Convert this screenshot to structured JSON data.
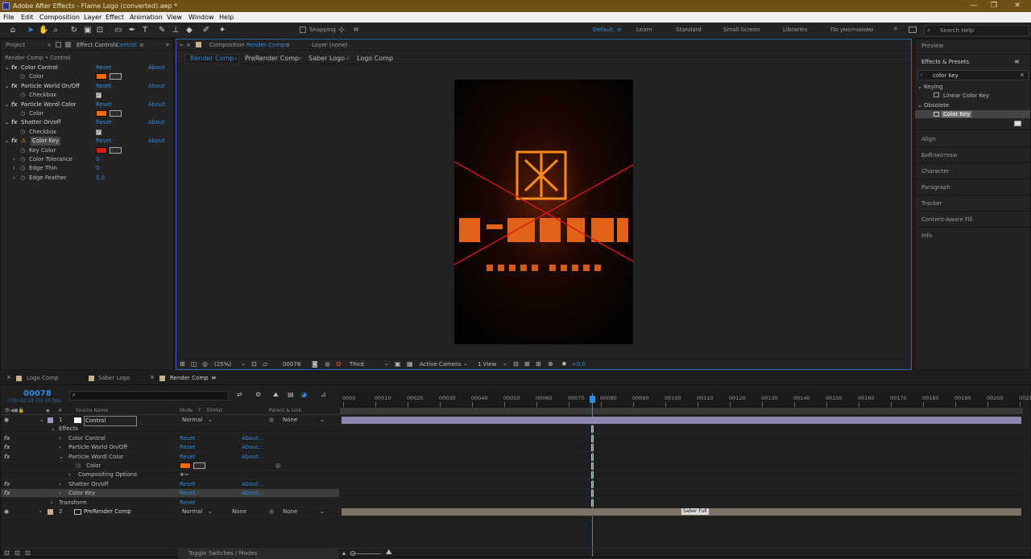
{
  "window": {
    "title": "Adobe After Effects - Flame Logo (converted).aep *",
    "controls": [
      "—",
      "❐",
      "✕"
    ]
  },
  "menu": [
    "File",
    "Edit",
    "Composition",
    "Layer",
    "Effect",
    "Animation",
    "View",
    "Window",
    "Help"
  ],
  "toolbar": {
    "snapping_label": "Snapping",
    "workspaces": [
      "Default",
      "Learn",
      "Standard",
      "Small Screen",
      "Libraries",
      "По умолчанию"
    ],
    "more": "»",
    "search_help_placeholder": "Search Help"
  },
  "left_panel": {
    "tab_project": "Project",
    "tab_effect_controls": "Effect Controls",
    "tab_effect_target": "Control",
    "breadcrumb": "Render Comp • Control",
    "effects": [
      {
        "fx": "fx",
        "name": "Color Control",
        "reset": "Reset",
        "about": "About"
      },
      {
        "fx": "",
        "name": "Color",
        "swatch": "#ff6a00"
      },
      {
        "fx": "fx",
        "name": "Particle World On/Off",
        "reset": "Reset",
        "about": "About"
      },
      {
        "fx": "",
        "name": "Checkbox",
        "checked": true
      },
      {
        "fx": "fx",
        "name": "Particle Wordl Color",
        "reset": "Reset",
        "about": "About"
      },
      {
        "fx": "",
        "name": "Color",
        "swatch": "#ff6a00"
      },
      {
        "fx": "fx",
        "name": "Shatter On/off",
        "reset": "Reset",
        "about": "About"
      },
      {
        "fx": "",
        "name": "Checkbox",
        "checked": true
      },
      {
        "fx": "fx",
        "name": "Color Key",
        "reset": "Reset",
        "about": "About",
        "warning": true
      },
      {
        "fx": "",
        "name": "Key Color",
        "swatch": "#e11818"
      },
      {
        "fx": "",
        "name": "Color Tolerance",
        "value": "0"
      },
      {
        "fx": "",
        "name": "Edge Thin",
        "value": "0"
      },
      {
        "fx": "",
        "name": "Edge Feather",
        "value": "0,0"
      }
    ]
  },
  "comp_panel": {
    "tab_comp": "Composition",
    "tab_comp_name": "Render Comp",
    "tab_layer": "Layer (none)",
    "nav": [
      "Render Comp",
      "PreRender Comp",
      "Saber Logo",
      "Logo Comp"
    ],
    "viewer_bottom": {
      "zoom": "(25%)",
      "frame": "00078",
      "resolution": "Third",
      "camera": "Active Camera",
      "views": "1 View",
      "exposure": "+0,0"
    }
  },
  "right_panel": {
    "preview": "Preview",
    "effects_presets": "Effects & Presets",
    "search_value": "color key",
    "tree": [
      {
        "label": "Keying",
        "level": 0
      },
      {
        "label": "Linear Color Key",
        "level": 1
      },
      {
        "label": "Obsolete",
        "level": 0
      },
      {
        "label": "Color Key",
        "level": 1,
        "selected": true
      }
    ],
    "panels": [
      "Align",
      "Библиотеки",
      "Character",
      "Paragraph",
      "Tracker",
      "Content-Aware Fill",
      "Info"
    ]
  },
  "timeline": {
    "tabs": [
      "Logo Comp",
      "Saber Logo",
      "Render Comp"
    ],
    "current_time": "00078",
    "time_sub": "0:00:02:18 (30.00 fps)",
    "columns": {
      "source": "Source Name",
      "mode": "Mode",
      "t": "T",
      "trkmat": "TrkMat",
      "parent": "Parent & Link"
    },
    "ruler": [
      "0000",
      "00010",
      "00020",
      "00030",
      "00040",
      "00050",
      "00060",
      "00070",
      "00080",
      "00090",
      "00100",
      "00110",
      "00120",
      "00130",
      "00140",
      "00150",
      "00160",
      "00170",
      "00180",
      "00190",
      "00200",
      "0021"
    ],
    "rows": [
      {
        "fx": "",
        "num": "1",
        "name": "Control",
        "mode": "Normal",
        "trk": "",
        "parent": "None",
        "type": "layer"
      },
      {
        "fx": "",
        "name": "Effects",
        "type": "group"
      },
      {
        "fx": "fx",
        "name": "Color Control",
        "reset": "Reset",
        "about": "About...",
        "type": "effect"
      },
      {
        "fx": "fx",
        "name": "Particle World On/Off",
        "reset": "Reset",
        "about": "About...",
        "type": "effect"
      },
      {
        "fx": "fx",
        "name": "Particle Wordl Color",
        "reset": "Reset",
        "about": "About...",
        "type": "effect"
      },
      {
        "fx": "",
        "name": "Color",
        "type": "prop",
        "swatch": "#ff6a00"
      },
      {
        "fx": "",
        "name": "Compositing Options",
        "type": "prop2",
        "extra": "+−"
      },
      {
        "fx": "fx",
        "name": "Shatter On/off",
        "reset": "Reset",
        "about": "About...",
        "type": "effect"
      },
      {
        "fx": "fx",
        "name": "Color Key",
        "reset": "Reset",
        "about": "About...",
        "type": "effect",
        "selected": true
      },
      {
        "fx": "",
        "name": "Transform",
        "reset": "Reset",
        "type": "group"
      },
      {
        "fx": "",
        "num": "2",
        "name": "PreRender Comp",
        "mode": "Normal",
        "trk": "None",
        "parent": "None",
        "type": "layer"
      }
    ],
    "bar_label": "Saber Full",
    "toggle": "Toggle Switches / Modes"
  },
  "colors": {
    "accent": "#2e8ce8",
    "orange": "#ff6a00",
    "red": "#e11818",
    "layer_purple": "#8b87ae",
    "layer_tan": "#7d7263"
  }
}
